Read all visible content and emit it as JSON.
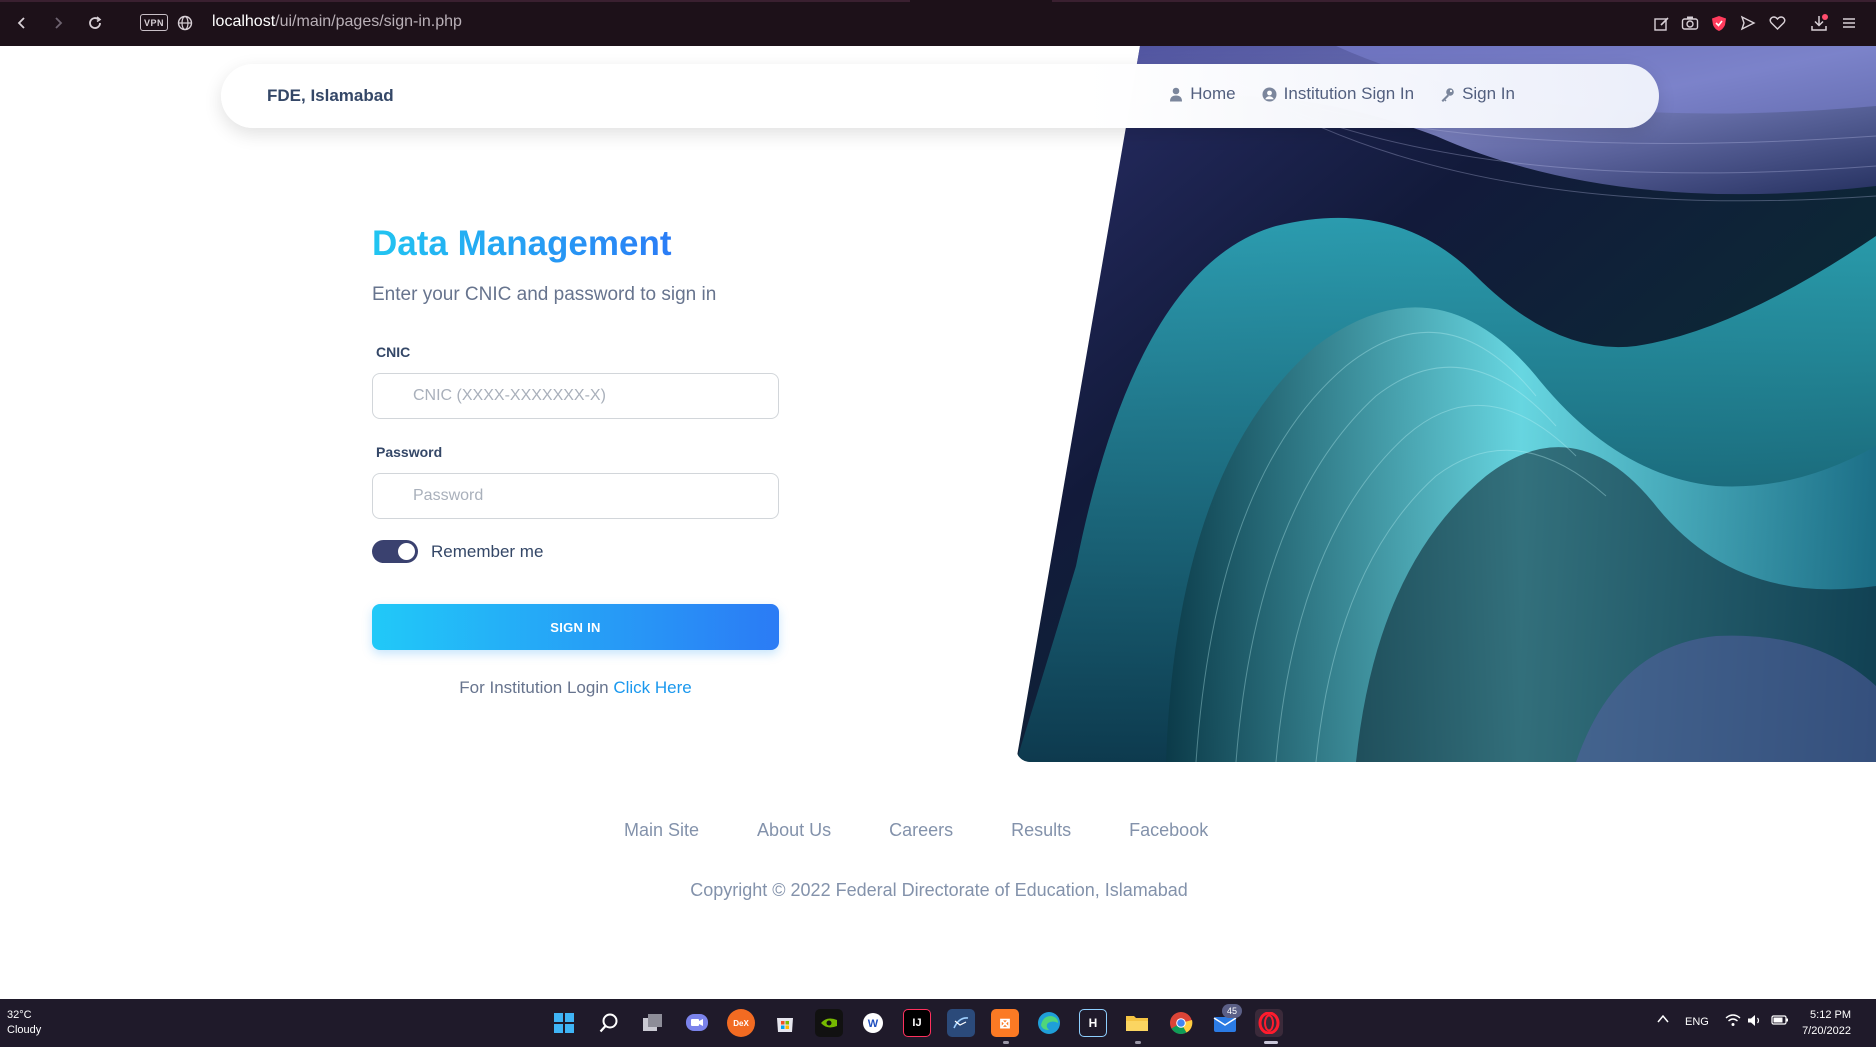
{
  "browser": {
    "url_host": "localhost",
    "url_path": "/ui/main/pages/sign-in.php",
    "vpn_label": "VPN"
  },
  "navbar": {
    "brand": "FDE, Islamabad",
    "links": [
      {
        "label": "Home",
        "icon": "user-icon"
      },
      {
        "label": "Institution Sign In",
        "icon": "user-circle-icon"
      },
      {
        "label": "Sign In",
        "icon": "key-icon"
      }
    ]
  },
  "form": {
    "title": "Data Management",
    "subtitle": "Enter your CNIC and password to sign in",
    "cnic_label": "CNIC",
    "cnic_placeholder": "CNIC (XXXX-XXXXXXX-X)",
    "password_label": "Password",
    "password_placeholder": "Password",
    "remember_label": "Remember me",
    "remember_checked": true,
    "submit_label": "SIGN IN",
    "institution_text": "For Institution Login",
    "institution_link": "Click Here"
  },
  "footer": {
    "links": [
      "Main Site",
      "About Us",
      "Careers",
      "Results",
      "Facebook"
    ],
    "copyright": "Copyright © 2022 Federal Directorate of Education, Islamabad"
  },
  "taskbar": {
    "weather_temp": "32°C",
    "weather_desc": "Cloudy",
    "mail_badge": "45",
    "language": "ENG",
    "time": "5:12 PM",
    "date": "7/20/2022"
  },
  "colors": {
    "accent_gradient_start": "#21c5f1",
    "accent_gradient_end": "#2a7cf6",
    "toggle_on": "#3a416f",
    "text_primary": "#344767"
  }
}
